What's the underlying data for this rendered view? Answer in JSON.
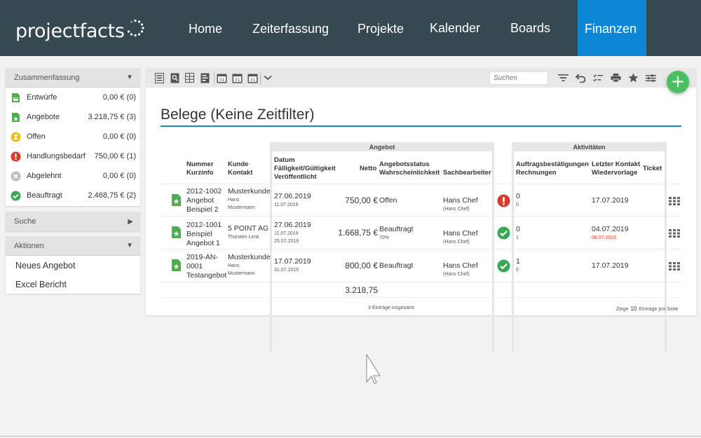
{
  "brand": {
    "name": "projectfacts"
  },
  "nav": [
    {
      "label": "Home"
    },
    {
      "label": "Zeiterfassung"
    },
    {
      "label": "Projekte"
    },
    {
      "label": "Kalender"
    },
    {
      "label": "Boards"
    },
    {
      "label": "Finanzen",
      "active": true
    }
  ],
  "summary": {
    "title": "Zusammenfassung",
    "items": [
      {
        "label": "Entwürfe",
        "value": "0,00 € (0)",
        "icon": "draft-doc-icon"
      },
      {
        "label": "Angebote",
        "value": "3.218,75 € (3)",
        "icon": "offer-star-icon"
      },
      {
        "label": "Offen",
        "value": "0,00 € (0)",
        "icon": "hourglass-icon"
      },
      {
        "label": "Handlungsbedarf",
        "value": "750,00 € (1)",
        "icon": "alert-icon"
      },
      {
        "label": "Abgelehnt",
        "value": "0,00 € (0)",
        "icon": "rejected-icon"
      },
      {
        "label": "Beauftragt",
        "value": "2.468,75 € (2)",
        "icon": "check-icon"
      }
    ]
  },
  "search_panel": {
    "title": "Suche"
  },
  "actions": {
    "title": "Aktionen",
    "items": [
      {
        "label": "Neues Angebot"
      },
      {
        "label": "Excel Bericht"
      }
    ]
  },
  "toolbar": {
    "search_placeholder": "Suchen",
    "add_label": "+"
  },
  "main": {
    "title": "Belege (Keine Zeitfilter)",
    "groups": {
      "angebot": "Angebot",
      "aktivitaeten": "Aktivitäten"
    },
    "columns": {
      "nummer": "Nummer",
      "kurzinfo": "Kurzinfo",
      "kunde": "Kunde",
      "kontakt": "Kontakt",
      "datum": "Datum",
      "faelligkeit": "Fälligkeit/Gültigkeit",
      "veroeffentlicht": "Veröffentlicht",
      "netto": "Netto",
      "angebotsstatus": "Angebotsstatus",
      "wahrscheinlichkeit": "Wahrscheinlichkeit",
      "sachbearbeiter": "Sachbearbeiter",
      "auftrag": "Auftragsbestätigungen",
      "rechnungen": "Rechnungen",
      "letzter_kontakt": "Letzter Kontakt",
      "wiedervorlage": "Wiedervorlage",
      "ticket": "Ticket"
    },
    "rows": [
      {
        "nummer": "2012-1002",
        "kurz1": "Angebot",
        "kurz2": "Beispiel 2",
        "kunde": "Musterkunde",
        "kontakt1": "Hans",
        "kontakt2": "Mustermann",
        "datum": "27.06.2019",
        "faellig": "11.07.2019",
        "veroeff": "",
        "netto": "750,00 €",
        "status": "Offen",
        "wahrsch": "",
        "sb": "Hans Chef",
        "sb_sub": "(Hans Chef)",
        "status_icon": "alert-icon",
        "auftrag": "0",
        "rechnungen": "0",
        "letzter": "17.07.2019",
        "wieder": ""
      },
      {
        "nummer": "2012-1001",
        "kurz1": "Beispiel",
        "kurz2": "Angebot 1",
        "kunde": "5 POINT AG",
        "kontakt1": "Thorsten Lenk",
        "kontakt2": "",
        "datum": "27.06.2019",
        "faellig": "11.07.2019",
        "veroeff": "25.07.2019",
        "netto": "1.668,75 €",
        "status": "Beauftragt",
        "wahrsch": "70%",
        "sb": "Hans Chef",
        "sb_sub": "(Hans Chef)",
        "status_icon": "check-icon",
        "auftrag": "0",
        "rechnungen": "1",
        "letzter": "04.07.2019",
        "wieder": "08.07.2019"
      },
      {
        "nummer": "2019-AN-",
        "kurz1": "0001",
        "kurz2": "Testangebot",
        "kunde": "Musterkunde",
        "kontakt1": "Hans",
        "kontakt2": "Mustermann",
        "datum": "17.07.2019",
        "faellig": "31.07.2019",
        "veroeff": "",
        "netto": "800,00 €",
        "status": "Beauftragt",
        "wahrsch": "",
        "sb": "Hans Chef",
        "sb_sub": "(Hans Chef)",
        "status_icon": "check-icon",
        "auftrag": "1",
        "rechnungen": "0",
        "letzter": "17.07.2019",
        "wieder": ""
      }
    ],
    "total": "3.218,75",
    "footer": {
      "count": "3 Einträge insgesamt",
      "show_prefix": "Zeige",
      "page_size": "10",
      "show_suffix": "Einträge pro Seite"
    }
  },
  "colors": {
    "topbar": "#364850",
    "active_nav": "#0f87d7",
    "accent_line": "#1c86c8",
    "fab": "#4cbf63",
    "alert": "#d43c2c",
    "check": "#3aa757"
  }
}
